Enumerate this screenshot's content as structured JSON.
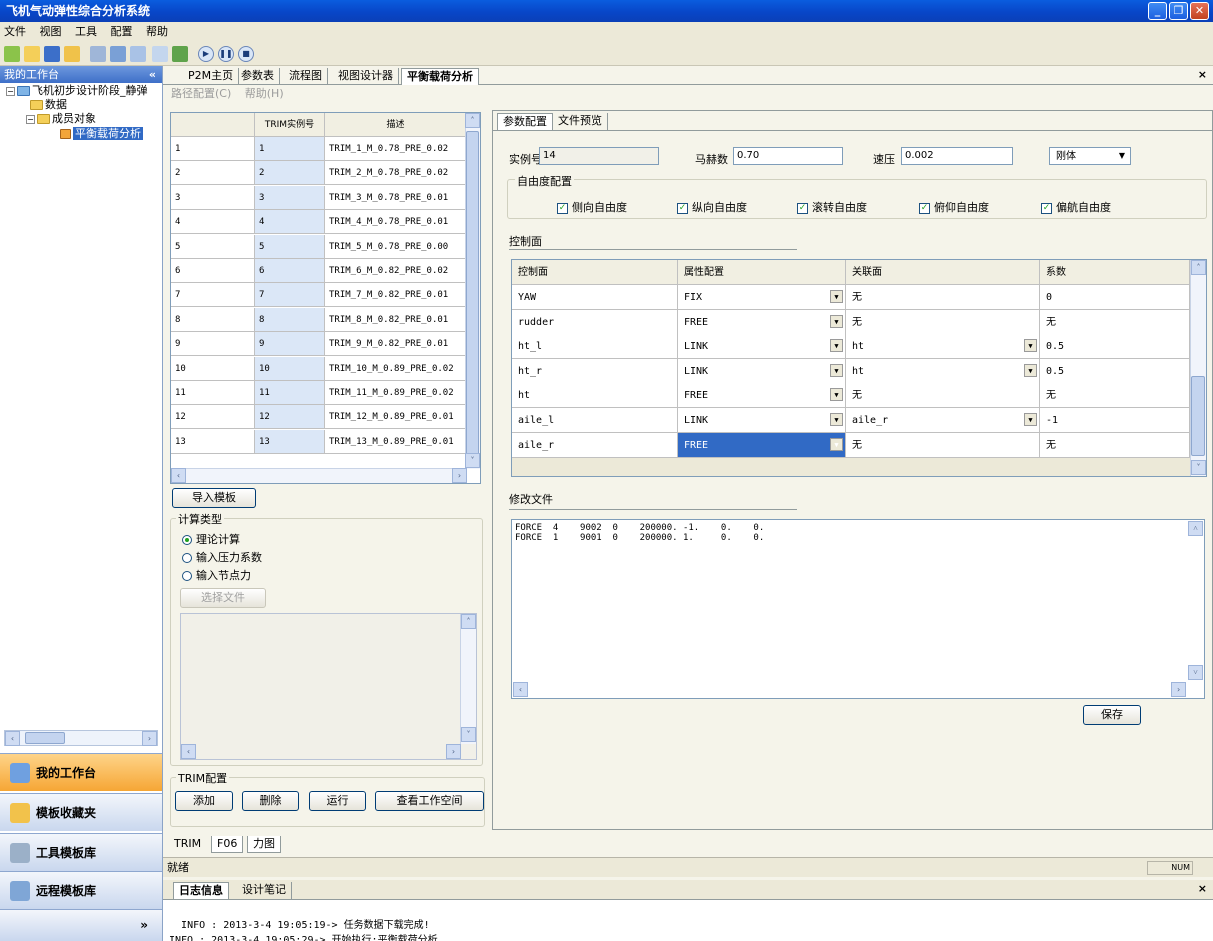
{
  "window": {
    "title": "飞机气动弹性综合分析系统"
  },
  "menu": [
    "文件",
    "视图",
    "工具",
    "配置",
    "帮助"
  ],
  "left": {
    "header": "我的工作台",
    "tree": {
      "root": "飞机初步设计阶段_静弹",
      "data": "数据",
      "members": "成员对象",
      "balance": "平衡载荷分析"
    },
    "nav": [
      "我的工作台",
      "模板收藏夹",
      "工具模板库",
      "远程模板库"
    ]
  },
  "tabs": [
    "P2M主页",
    "参数表",
    "流程图",
    "视图设计器",
    "平衡载荷分析"
  ],
  "subbar": {
    "path": "路径配置(C)",
    "help": "帮助(H)"
  },
  "trim_table": {
    "headers": [
      "",
      "TRIM实例号",
      "描述"
    ],
    "rows": [
      [
        "1",
        "1",
        "TRIM_1_M_0.78_PRE_0.02"
      ],
      [
        "2",
        "2",
        "TRIM_2_M_0.78_PRE_0.02"
      ],
      [
        "3",
        "3",
        "TRIM_3_M_0.78_PRE_0.01"
      ],
      [
        "4",
        "4",
        "TRIM_4_M_0.78_PRE_0.01"
      ],
      [
        "5",
        "5",
        "TRIM_5_M_0.78_PRE_0.00"
      ],
      [
        "6",
        "6",
        "TRIM_6_M_0.82_PRE_0.02"
      ],
      [
        "7",
        "7",
        "TRIM_7_M_0.82_PRE_0.01"
      ],
      [
        "8",
        "8",
        "TRIM_8_M_0.82_PRE_0.01"
      ],
      [
        "9",
        "9",
        "TRIM_9_M_0.82_PRE_0.01"
      ],
      [
        "10",
        "10",
        "TRIM_10_M_0.89_PRE_0.02"
      ],
      [
        "11",
        "11",
        "TRIM_11_M_0.89_PRE_0.02"
      ],
      [
        "12",
        "12",
        "TRIM_12_M_0.89_PRE_0.01"
      ],
      [
        "13",
        "13",
        "TRIM_13_M_0.89_PRE_0.01"
      ]
    ]
  },
  "import_button": "导入模板",
  "calc": {
    "title": "计算类型",
    "options": [
      "理论计算",
      "输入压力系数",
      "输入节点力"
    ],
    "choose_file": "选择文件"
  },
  "trim_config": {
    "title": "TRIM配置",
    "buttons": [
      "添加",
      "删除",
      "运行",
      "查看工作空间"
    ]
  },
  "right": {
    "tabs": [
      "参数配置",
      "文件预览"
    ],
    "instance_label": "实例号",
    "instance_value": "14",
    "mach_label": "马赫数",
    "mach_value": "0.70",
    "pressure_label": "速压",
    "pressure_value": "0.002",
    "body_type": "刚体",
    "dof_title": "自由度配置",
    "dof": [
      "侧向自由度",
      "纵向自由度",
      "滚转自由度",
      "俯仰自由度",
      "偏航自由度"
    ],
    "control_title": "控制面",
    "control_headers": [
      "控制面",
      "属性配置",
      "关联面",
      "系数"
    ],
    "control_rows": [
      [
        "YAW",
        "FIX",
        "无",
        "0"
      ],
      [
        "rudder",
        "FREE",
        "无",
        "无"
      ],
      [
        "ht_l",
        "LINK",
        "ht",
        "0.5"
      ],
      [
        "ht_r",
        "LINK",
        "ht",
        "0.5"
      ],
      [
        "ht",
        "FREE",
        "无",
        "无"
      ],
      [
        "aile_l",
        "LINK",
        "aile_r",
        "-1"
      ],
      [
        "aile_r",
        "FREE",
        "无",
        "无"
      ]
    ],
    "file_title": "修改文件",
    "file_lines": "FORCE  4    9002  0    200000. -1.    0.    0.\nFORCE  1    9001  0    200000. 1.     0.    0.",
    "save": "保存"
  },
  "sheet_tabs": [
    "TRIM",
    "F06",
    "力图"
  ],
  "status": {
    "text": "就绪",
    "num": "NUM"
  },
  "log": {
    "tabs": [
      "日志信息",
      "设计笔记"
    ],
    "lines": "INFO : 2013-3-4 19:05:19-> 任务数据下载完成!\nINFO : 2013-3-4 19:05:29-> 开始执行:平衡载荷分析 ..."
  },
  "colors": {
    "titlebar": "#0a5ddf",
    "selection": "#316ac5",
    "nav_active": "#f6a635"
  }
}
